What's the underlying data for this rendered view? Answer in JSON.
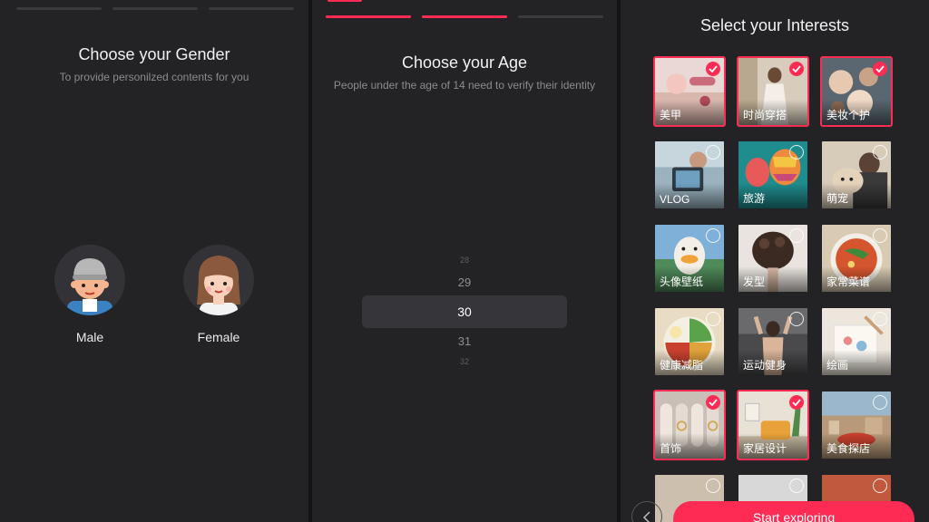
{
  "gender_screen": {
    "title": "Choose your Gender",
    "subtitle": "To provide personilzed contents for you",
    "options": [
      {
        "label": "Male"
      },
      {
        "label": "Female"
      }
    ]
  },
  "age_screen": {
    "title": "Choose your Age",
    "subtitle": "People under the age of 14 need to verify their identity",
    "ages": [
      "28",
      "29",
      "30",
      "31",
      "32"
    ],
    "selected": "30"
  },
  "interests_screen": {
    "title": "Select your Interests",
    "tiles": [
      {
        "label": "美甲",
        "selected": true
      },
      {
        "label": "时尚穿搭",
        "selected": true
      },
      {
        "label": "美妆个护",
        "selected": true
      },
      {
        "label": "VLOG",
        "selected": false
      },
      {
        "label": "旅游",
        "selected": false
      },
      {
        "label": "萌宠",
        "selected": false
      },
      {
        "label": "头像壁纸",
        "selected": false
      },
      {
        "label": "发型",
        "selected": false
      },
      {
        "label": "家常菜谱",
        "selected": false
      },
      {
        "label": "健康减脂",
        "selected": false
      },
      {
        "label": "运动健身",
        "selected": false
      },
      {
        "label": "绘画",
        "selected": false
      },
      {
        "label": "首饰",
        "selected": true
      },
      {
        "label": "家居设计",
        "selected": true
      },
      {
        "label": "美食探店",
        "selected": false
      }
    ],
    "start_label": "Start exploring"
  },
  "colors": {
    "accent": "#fe2c55",
    "panel_bg": "#232326",
    "page_bg": "#141416"
  }
}
